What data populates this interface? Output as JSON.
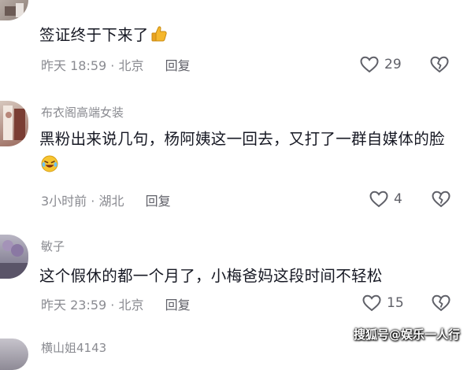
{
  "comments": [
    {
      "username": "",
      "content": "签证终于下来了",
      "emoji": "thumbs-up",
      "time": "昨天 18:59",
      "location": "北京",
      "reply_label": "回复",
      "likes": "29"
    },
    {
      "username": "布衣阁高端女装",
      "content": "黑粉出来说几句，杨阿姨这一回去，又打了一群自媒体的脸",
      "emoji": "laughing-crying",
      "time": "3小时前",
      "location": "湖北",
      "reply_label": "回复",
      "likes": "4"
    },
    {
      "username": "敏子",
      "content": "这个假休的都一个月了，小梅爸妈这段时间不轻松",
      "emoji": "",
      "time": "昨天 23:59",
      "location": "北京",
      "reply_label": "回复",
      "likes": "15"
    },
    {
      "username": "横山姐4143"
    }
  ],
  "separator": "·",
  "watermark": {
    "prefix": "搜狐号",
    "at": "@",
    "account": "娱乐一人行"
  },
  "colors": {
    "text": "#161823",
    "meta": "#8a8b91",
    "icon": "#5f6068"
  }
}
